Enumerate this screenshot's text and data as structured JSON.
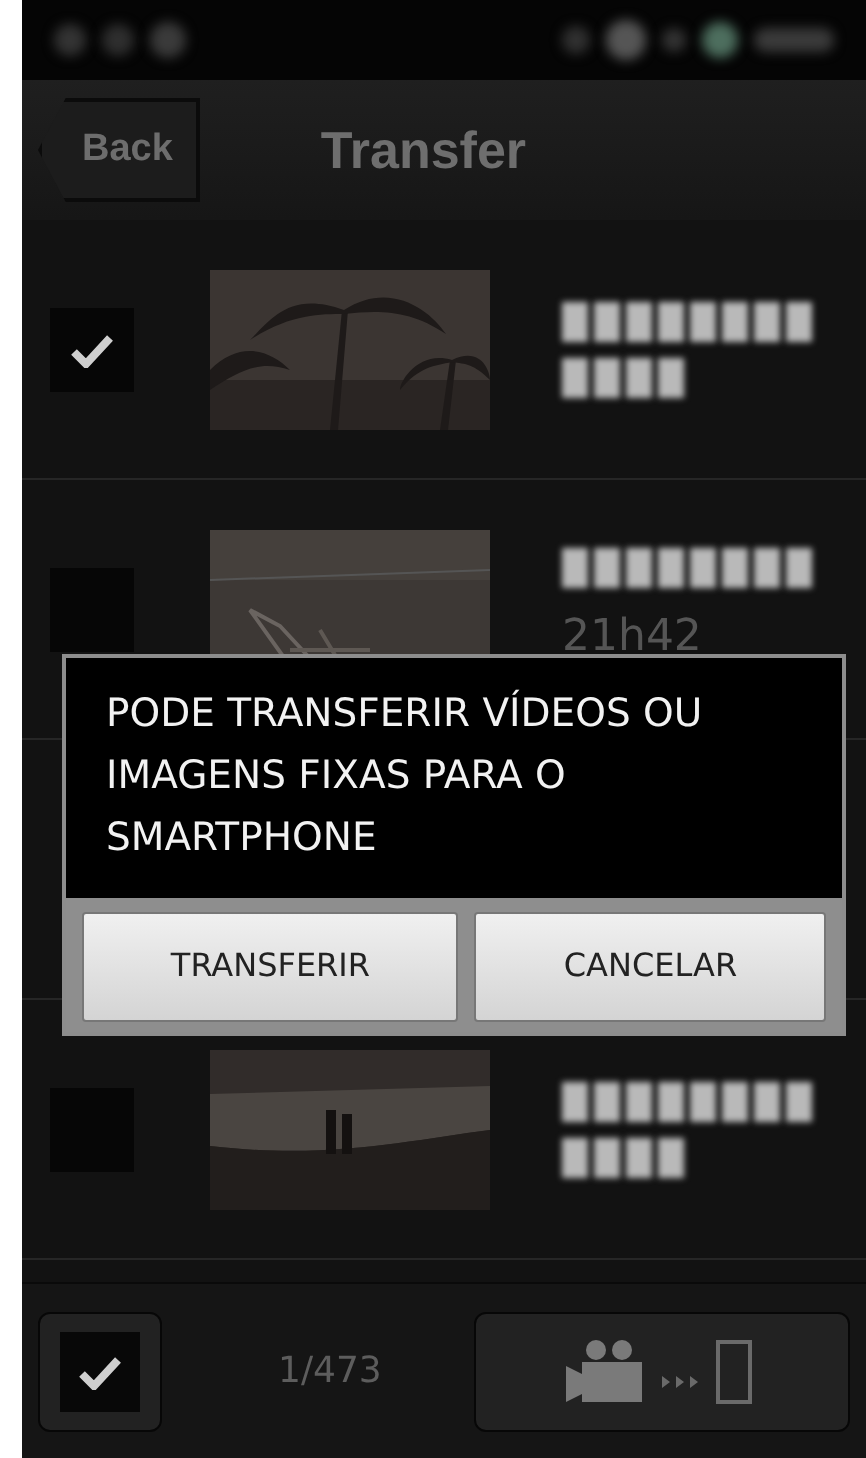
{
  "header": {
    "back_label": "Back",
    "title": "Transfer"
  },
  "items": [
    {
      "checked": true
    },
    {
      "checked": false,
      "time": "21h42"
    },
    {
      "checked": false
    }
  ],
  "dialog": {
    "message": "PODE TRANSFERIR VÍDEOS OU IMAGENS FIXAS PARA O SMARTPHONE",
    "buttons": [
      "TRANSFERIR",
      "CANCELAR"
    ]
  },
  "bottom_bar": {
    "select_all_checked": true,
    "counter": "1/473"
  }
}
